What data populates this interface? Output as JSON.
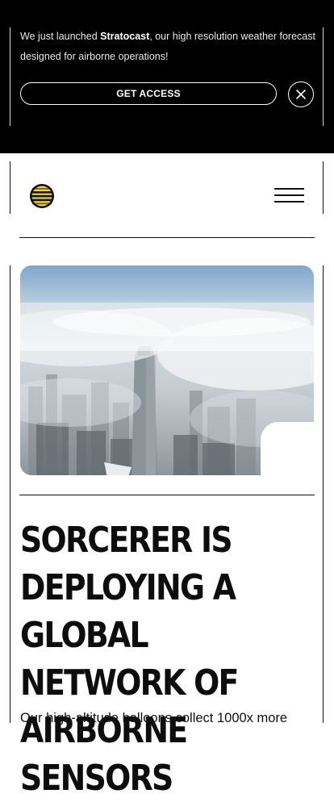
{
  "banner": {
    "text_before": "We just launched ",
    "product_name": "Stratocast",
    "text_after": ", our high resolution weather forecast designed for airborne operations!",
    "cta_label": "GET ACCESS"
  },
  "header": {
    "logo_icon": "sorcerer-logo-icon",
    "menu_icon": "hamburger-menu-icon"
  },
  "hero": {
    "headline": "SORCERER IS DEPLOYING A GLOBAL NETWORK OF AIRBORNE SENSORS",
    "subtext": "Our high-altitude balloons collect 1000x more"
  },
  "colors": {
    "banner_bg": "#000000",
    "logo_yellow": "#f2d62e",
    "text": "#111111"
  }
}
